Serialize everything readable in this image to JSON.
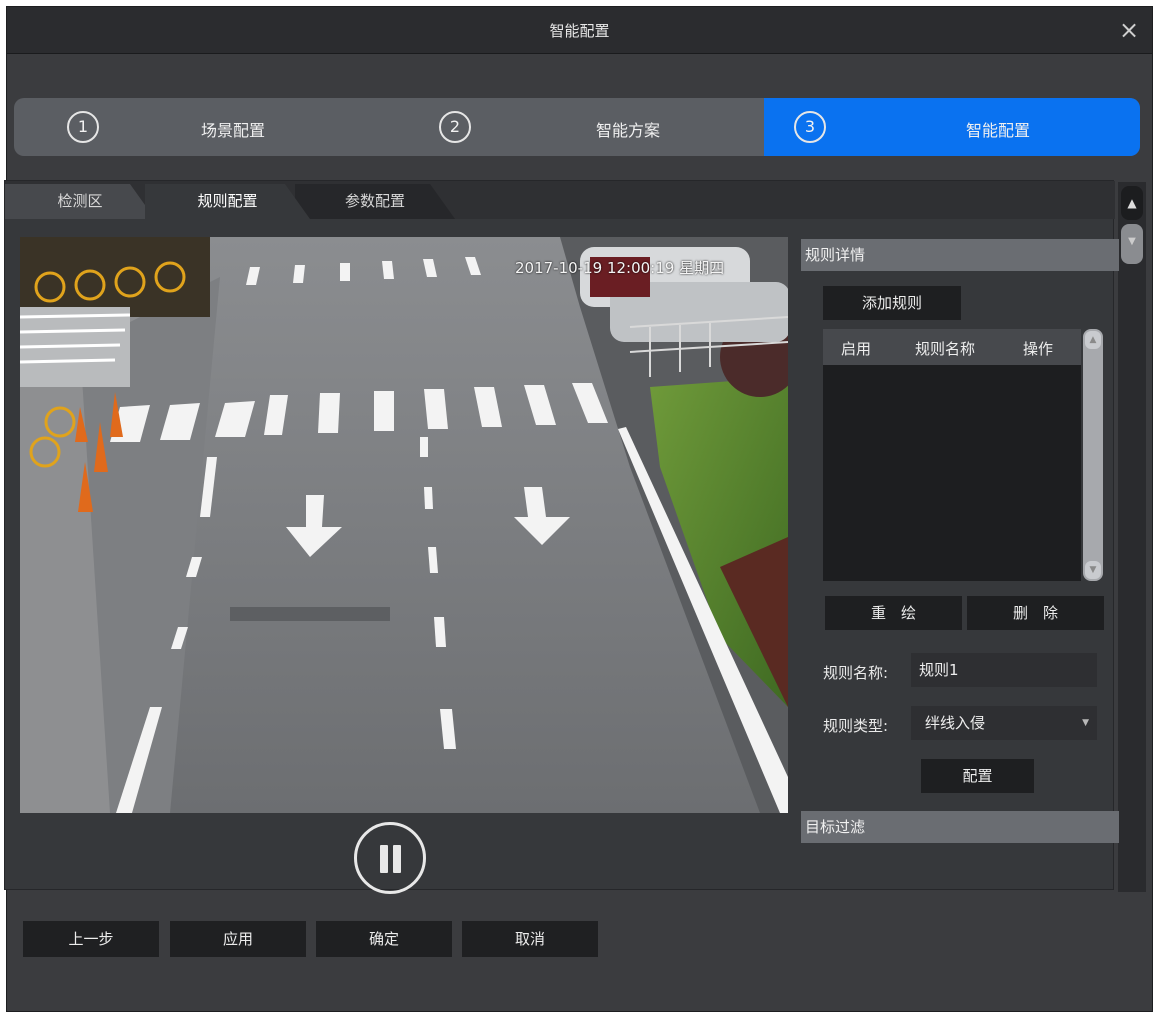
{
  "window": {
    "title": "智能配置",
    "close_icon": "×"
  },
  "steps": [
    {
      "num": "1",
      "label": "场景配置",
      "active": false
    },
    {
      "num": "2",
      "label": "智能方案",
      "active": false
    },
    {
      "num": "3",
      "label": "智能配置",
      "active": true
    }
  ],
  "tabs": [
    {
      "label": "检测区",
      "active": false
    },
    {
      "label": "规则配置",
      "active": true
    },
    {
      "label": "参数配置",
      "active": false
    }
  ],
  "video": {
    "osd_text": "2017-10-19 12:00:19 星期四"
  },
  "rule_detail": {
    "header": "规则详情",
    "add_label": "添加规则",
    "columns": [
      "启用",
      "规则名称",
      "操作"
    ],
    "rows": [],
    "redraw_label": "重　绘",
    "delete_label": "删　除",
    "name_label": "规则名称:",
    "name_value": "规则1",
    "type_label": "规则类型:",
    "type_value": "绊线入侵",
    "config_label": "配置"
  },
  "target_filter": {
    "header": "目标过滤"
  },
  "footer": {
    "prev": "上一步",
    "apply": "应用",
    "ok": "确定",
    "cancel": "取消"
  },
  "colors": {
    "accent": "#0a72f0",
    "background": "#3b3c3f",
    "titlebar": "#2b2c2f"
  }
}
